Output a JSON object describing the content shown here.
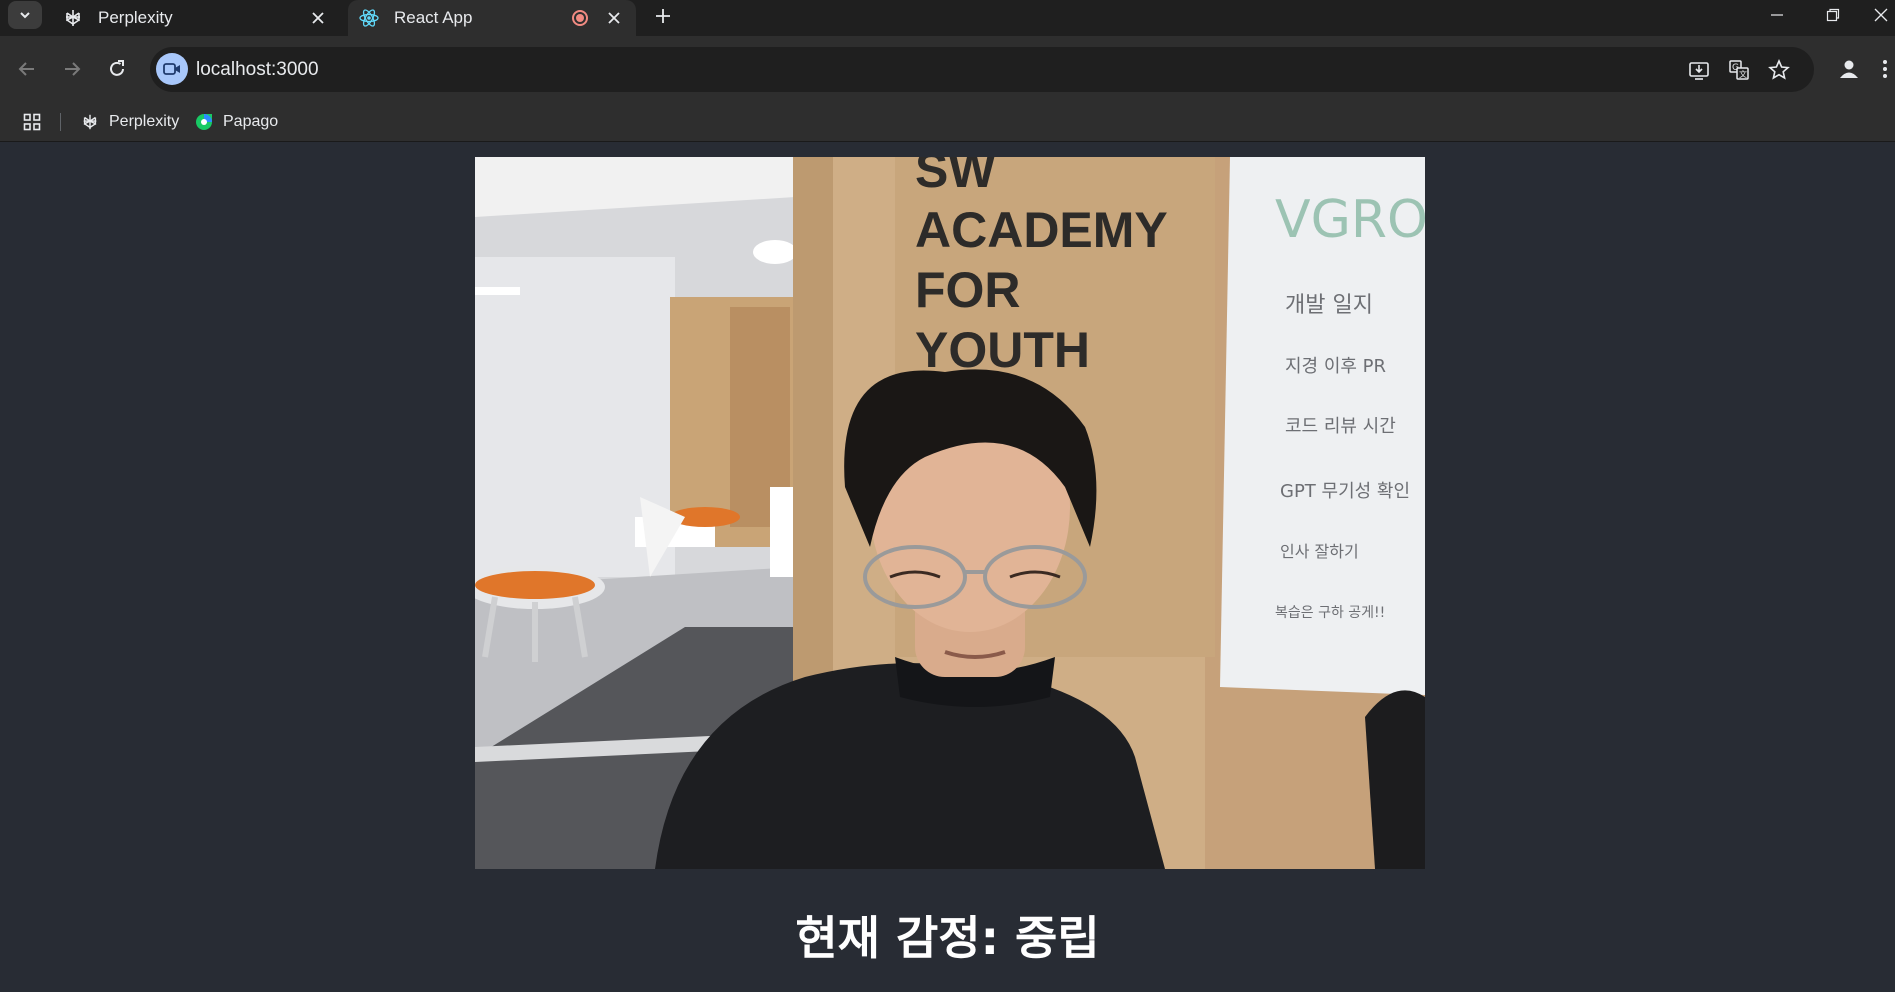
{
  "tabs": [
    {
      "title": "Perplexity",
      "favicon": "perplexity-icon",
      "active": false
    },
    {
      "title": "React App",
      "favicon": "react-icon",
      "active": true,
      "recording": true
    }
  ],
  "address_bar": {
    "url": "localhost:3000"
  },
  "bookmarks": [
    {
      "label": "Perplexity",
      "icon": "perplexity-icon"
    },
    {
      "label": "Papago",
      "icon": "papago-icon"
    }
  ],
  "webcam": {
    "wall_sign": [
      "SW",
      "ACADEMY",
      "FOR",
      "YOUTH"
    ],
    "poster_header": "VGRO",
    "poster_items": [
      "개발 일지",
      "지경 이후 PR",
      "코드 리뷰 시간",
      "GPT 무기성 확인",
      "인사 잘하기",
      "복습은 구하 공게!!"
    ]
  },
  "page": {
    "emotion_text": "현재 감정: 중립"
  },
  "colors": {
    "page_bg": "#282c34",
    "chrome_dark": "#1f1f1f",
    "chrome": "#2e2e2e",
    "text": "#e8eaed",
    "recording": "#f28b82",
    "site_chip": "#a8c7fa"
  }
}
